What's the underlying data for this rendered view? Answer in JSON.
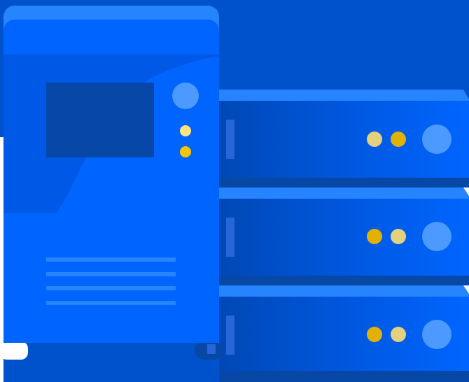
{
  "illustration": {
    "subject": "server-illustration",
    "colors": {
      "backdrop": "#0052CC",
      "tower_body": "#0065FF",
      "tower_top": "#2684FF",
      "tower_dark": "#0052CC",
      "screen": "#0747A6",
      "rack_front_light": "#0065FF",
      "rack_front_dark": "#0052CC",
      "rack_top": "#2684FF",
      "rack_gap": "#0747A6",
      "button_light": "#4C9AFF",
      "lamp_yellow": "#FFC400",
      "lamp_pale": "#FFE380",
      "lamp_gold": "#E2B203",
      "lamp_cream": "#E3D17E",
      "vent_line": "#2684FF"
    },
    "rack_units": [
      {
        "lamps": [
          "lamp_cream",
          "lamp_gold"
        ]
      },
      {
        "lamps": [
          "lamp_gold",
          "lamp_cream"
        ]
      },
      {
        "lamps": [
          "lamp_gold",
          "lamp_cream"
        ]
      }
    ],
    "tower_lamps": [
      "lamp_pale",
      "lamp_yellow"
    ]
  }
}
